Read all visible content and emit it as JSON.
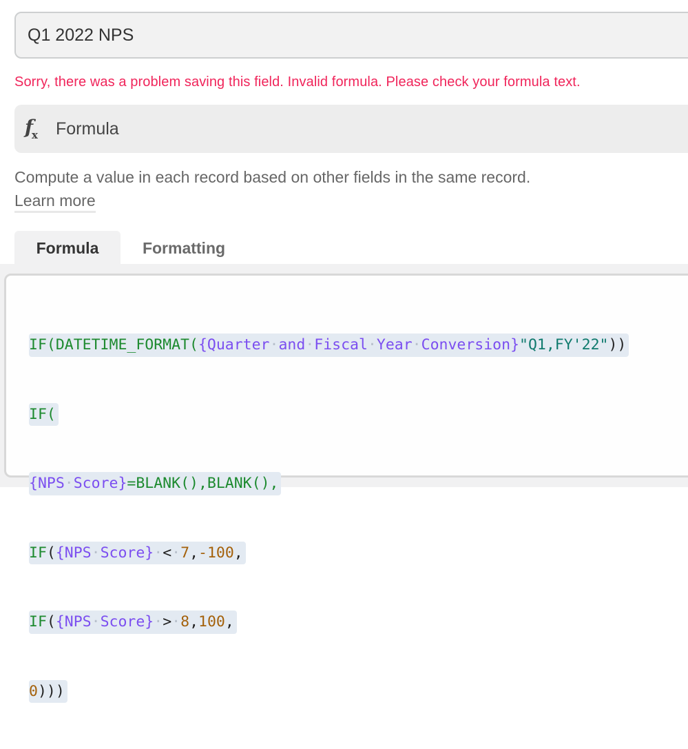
{
  "field": {
    "name_value": "Q1 2022 NPS",
    "error_message": "Sorry, there was a problem saving this field. Invalid formula. Please check your formula text."
  },
  "field_type": {
    "icon": "function-fx-icon",
    "label": "Formula"
  },
  "description": {
    "text": "Compute a value in each record based on other fields in the same record.",
    "link": "Learn more"
  },
  "tabs": [
    {
      "label": "Formula",
      "active": true
    },
    {
      "label": "Formatting",
      "active": false
    }
  ],
  "formula": {
    "lines": [
      "IF(DATETIME_FORMAT({Quarter and Fiscal Year Conversion}\"Q1,FY'22\"))",
      "IF(",
      "{NPS Score}=BLANK(),BLANK(),",
      "IF({NPS Score} < 7,-100,",
      "IF({NPS Score} > 8,100,",
      "0)))"
    ],
    "tokens": {
      "l1": {
        "fn": "IF(DATETIME_FORMAT(",
        "field": "{Quarter·and·Fiscal·Year·Conversion}",
        "str": "\"Q1,FY'22\"",
        "close": "))"
      },
      "l2": {
        "fn": "IF("
      },
      "l3": {
        "field": "{NPS·Score}",
        "fn": "=BLANK(),BLANK(),"
      },
      "l4": {
        "fn": "IF",
        "open": "(",
        "field": "{NPS·Score}",
        "op": " < ",
        "num1": "7",
        "sep": ",",
        "num2": "-100",
        "end": ","
      },
      "l5": {
        "fn": "IF",
        "open": "(",
        "field": "{NPS·Score}",
        "op": " > ",
        "num1": "8",
        "sep": ",",
        "num2": "100",
        "end": ","
      },
      "l6": {
        "num": "0",
        "close": ")))"
      }
    }
  },
  "colors": {
    "error": "#f0245a",
    "function": "#1d8a2f",
    "field_ref": "#7b4ef0",
    "string": "#0f7a6d",
    "number": "#a4610b"
  }
}
